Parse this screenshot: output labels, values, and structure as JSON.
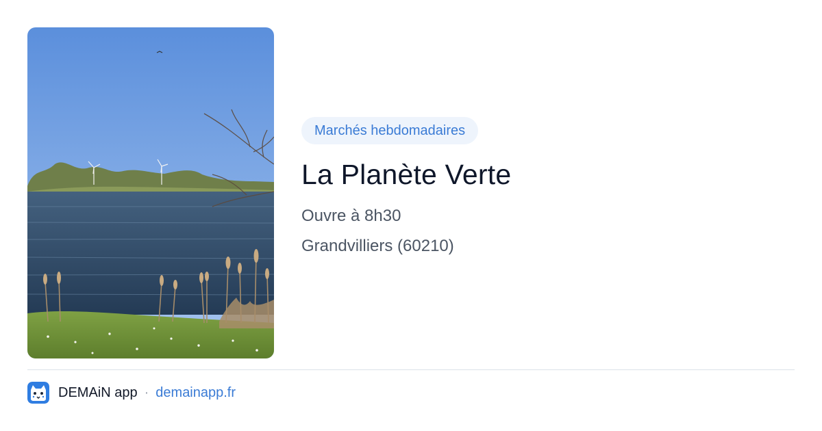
{
  "event": {
    "category": "Marchés hebdomadaires",
    "title": "La Planète Verte",
    "opening": "Ouvre à 8h30",
    "location": "Grandvilliers (60210)"
  },
  "footer": {
    "app_name": "DEMAiN app",
    "separator": "·",
    "site": "demainapp.fr"
  },
  "colors": {
    "accent": "#3a7bd5",
    "badge_background": "#eef4fc",
    "title": "#0f172a",
    "meta_text": "#4b5563",
    "divider": "#dbe2e8"
  },
  "icons": {
    "app_logo": "cat-face-app-icon"
  }
}
